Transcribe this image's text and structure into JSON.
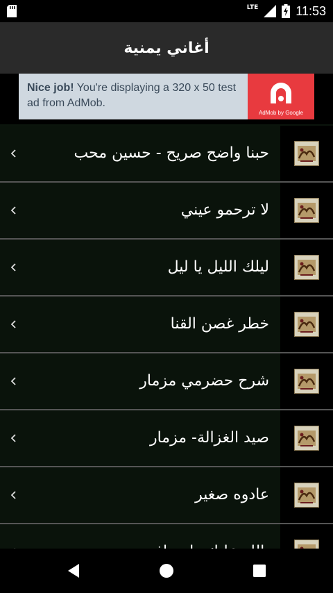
{
  "status_bar": {
    "network": "LTE",
    "time": "11:53"
  },
  "app_bar": {
    "title": "أغاني يمنية"
  },
  "ad": {
    "bold_text": "Nice job!",
    "text": " You're displaying a 320 x 50 test ad from AdMob.",
    "caption": "AdMob by Google",
    "accent_color": "#e83a3f"
  },
  "list": {
    "items": [
      {
        "label": "حبنا واضح صريح - حسين محب"
      },
      {
        "label": "لا ترحمو عيني"
      },
      {
        "label": "ليلك الليل يا ليل"
      },
      {
        "label": "خطر غصن القنا"
      },
      {
        "label": "شرح حضرمي مزمار"
      },
      {
        "label": "صيد الغزالة- مزمار"
      },
      {
        "label": "عادوه صغير"
      },
      {
        "label": "بالله عليك وامسافر"
      }
    ]
  },
  "nav": {
    "back": "back-icon",
    "home": "home-icon",
    "recents": "recents-icon"
  }
}
